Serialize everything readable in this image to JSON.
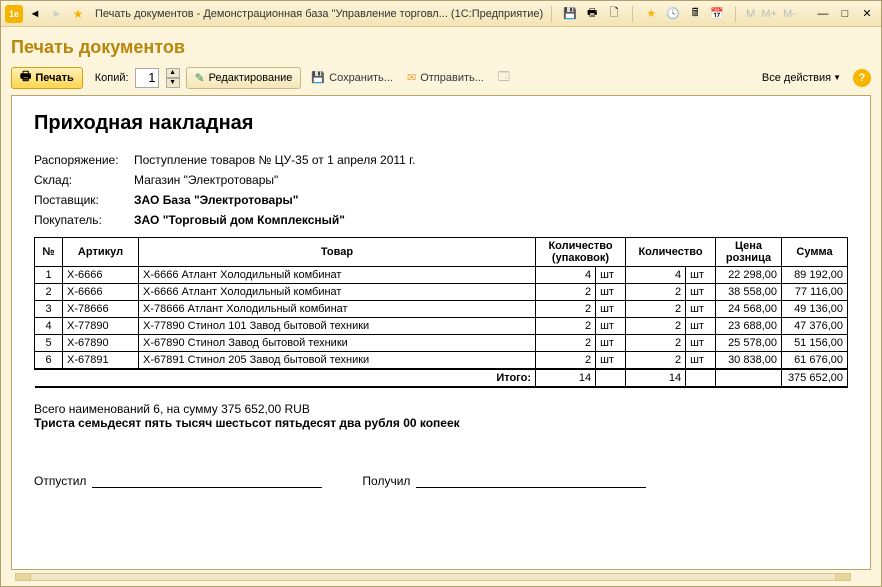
{
  "titlebar": {
    "title": "Печать документов - Демонстрационная база \"Управление торговл... (1С:Предприятие)"
  },
  "page": {
    "title": "Печать документов"
  },
  "toolbar": {
    "print": "Печать",
    "copies_label": "Копий:",
    "copies_value": "1",
    "edit": "Редактирование",
    "save": "Сохранить...",
    "send": "Отправить...",
    "all_actions": "Все действия"
  },
  "document": {
    "title": "Приходная накладная",
    "meta": {
      "order_label": "Распоряжение:",
      "order_value": "Поступление товаров № ЦУ-35 от 1 апреля 2011 г.",
      "warehouse_label": "Склад:",
      "warehouse_value": "Магазин \"Электротовары\"",
      "supplier_label": "Поставщик:",
      "supplier_value": "ЗАО База \"Электротовары\"",
      "buyer_label": "Покупатель:",
      "buyer_value": "ЗАО \"Торговый дом Комплексный\""
    },
    "columns": [
      "№",
      "Артикул",
      "Товар",
      "Количество (упаковок)",
      "",
      "Количество",
      "",
      "Цена розница",
      "Сумма"
    ],
    "rows": [
      {
        "n": "1",
        "art": "X-6666",
        "name": "X-6666 Атлант Холодильный комбинат",
        "qp": "4",
        "up": "шт",
        "q": "4",
        "u": "шт",
        "price": "22 298,00",
        "sum": "89 192,00"
      },
      {
        "n": "2",
        "art": "X-6666",
        "name": "X-6666 Атлант Холодильный комбинат",
        "qp": "2",
        "up": "шт",
        "q": "2",
        "u": "шт",
        "price": "38 558,00",
        "sum": "77 116,00"
      },
      {
        "n": "3",
        "art": "X-78666",
        "name": "X-78666 Атлант Холодильный комбинат",
        "qp": "2",
        "up": "шт",
        "q": "2",
        "u": "шт",
        "price": "24 568,00",
        "sum": "49 136,00"
      },
      {
        "n": "4",
        "art": "X-77890",
        "name": "X-77890 Стинол 101 Завод бытовой техники",
        "qp": "2",
        "up": "шт",
        "q": "2",
        "u": "шт",
        "price": "23 688,00",
        "sum": "47 376,00"
      },
      {
        "n": "5",
        "art": "X-67890",
        "name": "X-67890 Стинол Завод бытовой техники",
        "qp": "2",
        "up": "шт",
        "q": "2",
        "u": "шт",
        "price": "25 578,00",
        "sum": "51 156,00"
      },
      {
        "n": "6",
        "art": "X-67891",
        "name": "X-67891 Стинол 205 Завод бытовой техники",
        "qp": "2",
        "up": "шт",
        "q": "2",
        "u": "шт",
        "price": "30 838,00",
        "sum": "61 676,00"
      }
    ],
    "totals": {
      "label": "Итого:",
      "qp": "14",
      "q": "14",
      "sum": "375 652,00"
    },
    "summary_line": "Всего наименований 6, на сумму 375 652,00 RUB",
    "summary_words": "Триста семьдесят пять тысяч шестьсот пятьдесят два рубля 00 копеек",
    "sign_out": "Отпустил",
    "sign_in": "Получил"
  }
}
